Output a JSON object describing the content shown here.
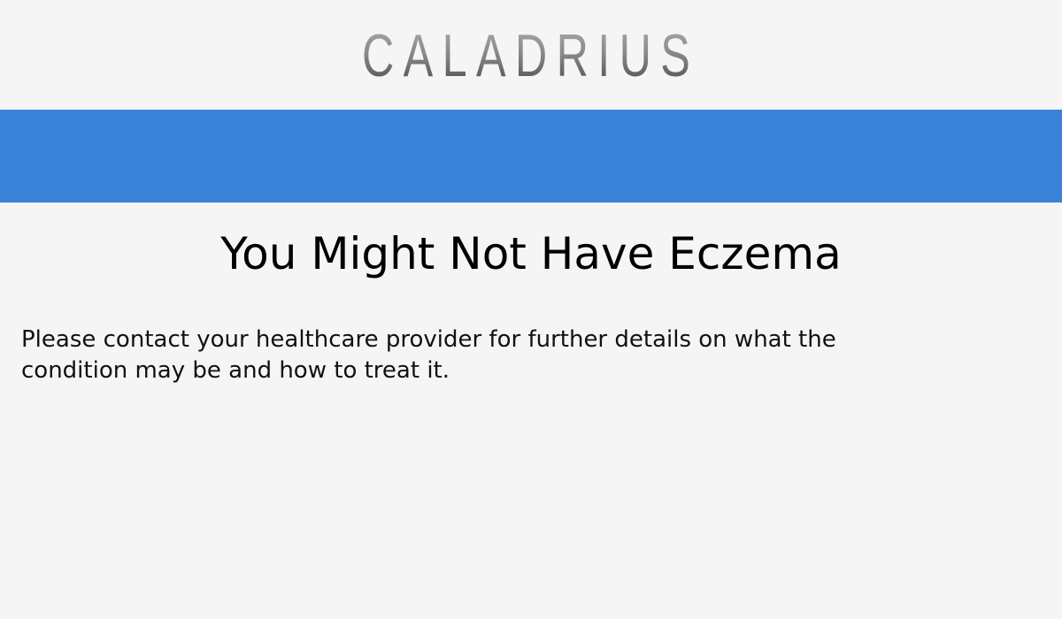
{
  "header": {
    "logo_text": "CALADRIUS"
  },
  "colors": {
    "background": "#f5f5f5",
    "accent_bar": "#3a82d8",
    "text": "#000000"
  },
  "result": {
    "title": "You Might Not Have Eczema",
    "message": "Please contact your healthcare provider for further details on what the condition may be and how to treat it."
  }
}
